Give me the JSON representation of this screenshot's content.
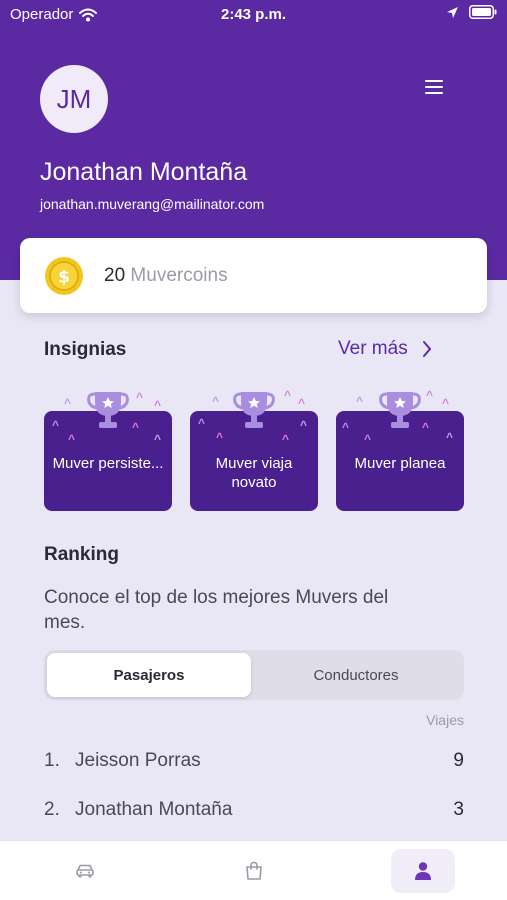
{
  "status_bar": {
    "carrier": "Operador",
    "time": "2:43 p.m."
  },
  "profile": {
    "initials": "JM",
    "name": "Jonathan Montaña",
    "email": "jonathan.muverang@mailinator.com"
  },
  "coins": {
    "count": "20",
    "label": "Muvercoins"
  },
  "badges": {
    "title": "Insignias",
    "see_more": "Ver más",
    "items": [
      {
        "label": "Muver persiste..."
      },
      {
        "label": "Muver viaja novato"
      },
      {
        "label": "Muver planea"
      }
    ]
  },
  "ranking": {
    "title": "Ranking",
    "description": "Conoce el top de los mejores Muvers del mes.",
    "tabs": [
      {
        "label": "Pasajeros",
        "selected": true
      },
      {
        "label": "Conductores",
        "selected": false
      }
    ],
    "column_header": "Viajes",
    "rows": [
      {
        "position": "1.",
        "name": "Jeisson Porras",
        "value": "9"
      },
      {
        "position": "2.",
        "name": "Jonathan Montaña",
        "value": "3"
      }
    ]
  },
  "tab_bar": {
    "items": [
      {
        "icon": "car-icon",
        "active": false
      },
      {
        "icon": "shopping-bag-icon",
        "active": false
      },
      {
        "icon": "person-icon",
        "active": true
      }
    ]
  },
  "colors": {
    "brand_purple": "#5b2aa3",
    "badge_purple": "#4a208f",
    "coin_gold": "#f2c61f",
    "background": "#e9e7f5"
  }
}
